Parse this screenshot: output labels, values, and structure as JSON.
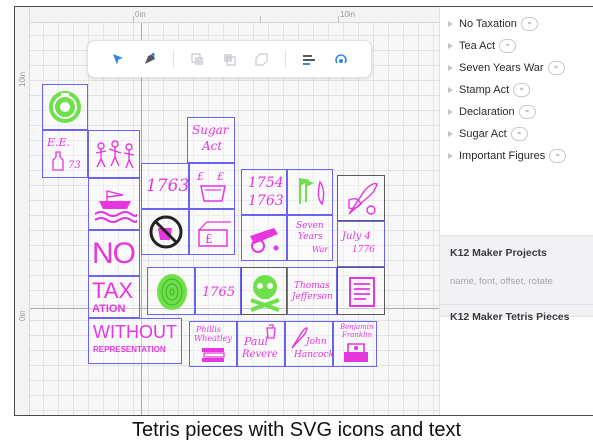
{
  "rulers": {
    "top_label_left": "0in",
    "top_label_right": "10in",
    "left_label_top": "10in",
    "left_label_bottom": "0in"
  },
  "toolbar": {
    "tools": [
      "select-arrow-icon",
      "node-edit-icon",
      "group-icon",
      "ungroup-icon",
      "combine-icon",
      "align-icon",
      "weld-icon"
    ]
  },
  "pieces": {
    "no_text": "NO",
    "tax_text": "TAX",
    "ation_text": "ATION",
    "without_text": "WITHOUT",
    "representation_text": "REPRESENTATION",
    "year_1763_a": "1763",
    "year_1763_b": "1763",
    "year_1754": "1754",
    "year_1765": "1765",
    "sugar_act_line1": "Sugar",
    "sugar_act_line2": "Act",
    "seven_years_line1": "Seven",
    "seven_years_line2": "Years",
    "seven_years_line3": "War",
    "july_line1": "July 4",
    "july_line2": "1776",
    "jefferson_line1": "Thomas",
    "jefferson_line2": "Jefferson",
    "wheatley_line1": "Phillis",
    "wheatley_line2": "Wheatley",
    "revere_line1": "Paul",
    "revere_line2": "Revere",
    "hancock_line1": "John",
    "hancock_line2": "Hancock",
    "franklin_line1": "Benjamin",
    "franklin_line2": "Franklin",
    "ee_text": "E.E.",
    "e73_text": "73"
  },
  "layers": [
    {
      "name": "No Taxation"
    },
    {
      "name": "Tea Act"
    },
    {
      "name": "Seven Years War"
    },
    {
      "name": "Stamp Act"
    },
    {
      "name": "Declaration"
    },
    {
      "name": "Sugar Act"
    },
    {
      "name": "Important Figures"
    }
  ],
  "projects": {
    "title1": "K12 Maker Projects",
    "subtitle1": "name, font, offset, rotate",
    "title2": "K12 Maker Tetris Pieces"
  },
  "caption": "Tetris pieces with SVG icons and text",
  "colors": {
    "piece_border": "#6b63f2",
    "engrave": "#e536e0",
    "fill_green": "#6ee04a",
    "accent_blue": "#2f86e6"
  }
}
